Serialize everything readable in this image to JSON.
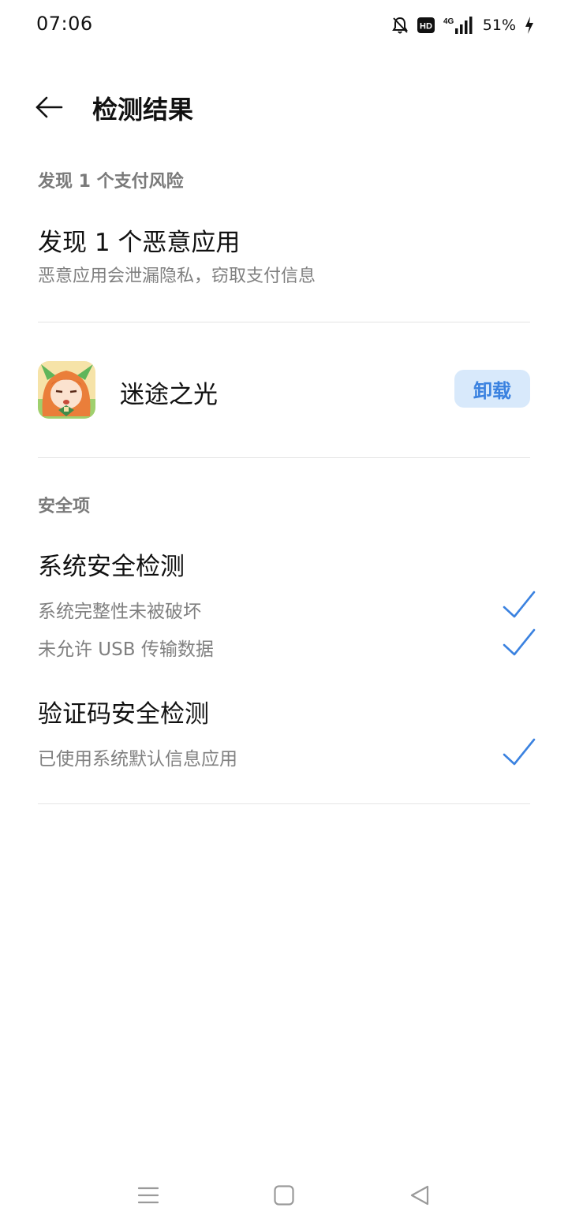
{
  "status_bar": {
    "time": "07:06",
    "network": "4G",
    "battery_percent": "51%",
    "icons": [
      "bell-off-icon",
      "hd-icon",
      "signal-4g-icon",
      "battery-charging-icon"
    ]
  },
  "header": {
    "title": "检测结果",
    "back_icon": "arrow-left-icon"
  },
  "risk_section": {
    "label": "发现 1 个支付风险",
    "title": "发现 1 个恶意应用",
    "description": "恶意应用会泄漏隐私，窃取支付信息"
  },
  "malicious_app": {
    "name": "迷途之光",
    "action_label": "卸载"
  },
  "security_section": {
    "label": "安全项",
    "groups": [
      {
        "title": "系统安全检测",
        "items": [
          {
            "text": "系统完整性未被破坏",
            "status": "passed"
          },
          {
            "text": "未允许 USB 传输数据",
            "status": "passed"
          }
        ]
      },
      {
        "title": "验证码安全检测",
        "items": [
          {
            "text": "已使用系统默认信息应用",
            "status": "passed"
          }
        ]
      }
    ]
  },
  "colors": {
    "accent": "#3b82e0",
    "accent_bg": "#d8e9fb",
    "secondary_text": "#808080",
    "divider": "#e4e4e4"
  },
  "nav_bar": {
    "buttons": [
      "menu-icon",
      "home-icon",
      "back-triangle-icon"
    ]
  }
}
